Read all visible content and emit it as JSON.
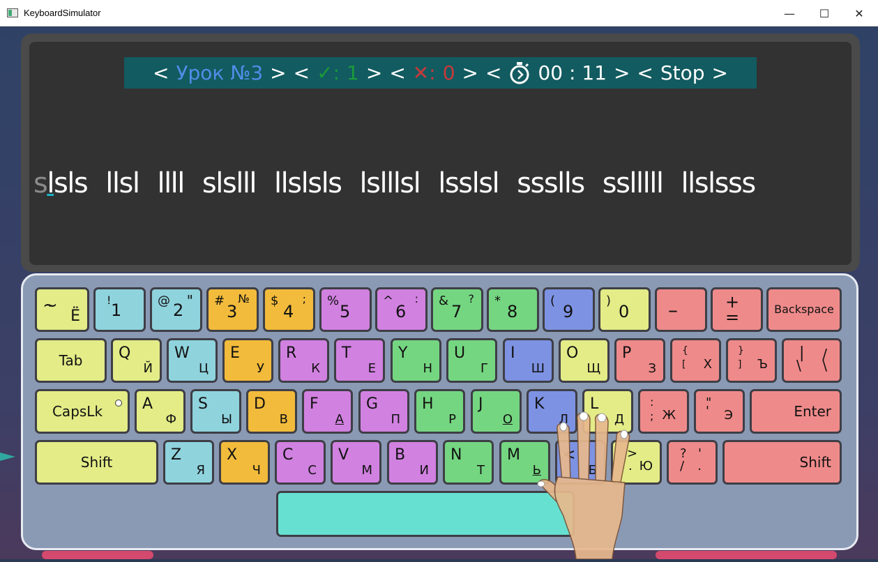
{
  "window": {
    "title": "KeyboardSimulator",
    "minimize": "—",
    "maximize": "☐",
    "close": "✕"
  },
  "status": {
    "lt1": "<",
    "lesson": "Урок №3",
    "gt1": ">",
    "lt2": "<",
    "correct_icon": "✓",
    "correct_label": ":",
    "correct": "1",
    "gt2": ">",
    "lt3": "<",
    "errors_icon": "✕",
    "errors_label": ":",
    "errors": "0",
    "gt3": ">",
    "lt4": "<",
    "time": "00 : 11",
    "gt4": ">",
    "lt5": "<",
    "stop": "Stop",
    "gt5": ">"
  },
  "exercise": {
    "typed": "s",
    "current": "l",
    "first_rest": "sls",
    "words": [
      "llsl",
      "llll",
      "slslll",
      "llslsls",
      "lslllsl",
      "lsslsl",
      "ssslls",
      "sslllll",
      "llslsss"
    ]
  },
  "keys": {
    "r1": [
      {
        "tl": "~",
        "bl": "`",
        "br": "Ё"
      },
      {
        "tl": "!",
        "main": "1"
      },
      {
        "tl": "@",
        "main": "2",
        "tr": "\""
      },
      {
        "tl": "#",
        "main": "3",
        "tr": "№"
      },
      {
        "tl": "$",
        "main": "4",
        "tr": ";"
      },
      {
        "tl": "%",
        "main": "5"
      },
      {
        "tl": "^",
        "main": "6",
        "tr": ":"
      },
      {
        "tl": "&",
        "main": "7",
        "tr": "?"
      },
      {
        "tl": "*",
        "main": "8"
      },
      {
        "tl": "(",
        "main": "9"
      },
      {
        "tl": ")",
        "main": "0"
      },
      {
        "main": "–"
      },
      {
        "tl": "+",
        "main": "="
      },
      {
        "label": "Backspace"
      }
    ],
    "r2": [
      {
        "label": "Tab"
      },
      {
        "tl": "Q",
        "br": "Й"
      },
      {
        "tl": "W",
        "br": "Ц"
      },
      {
        "tl": "E",
        "br": "У"
      },
      {
        "tl": "R",
        "br": "К"
      },
      {
        "tl": "T",
        "br": "Е"
      },
      {
        "tl": "Y",
        "br": "Н"
      },
      {
        "tl": "U",
        "br": "Г"
      },
      {
        "tl": "I",
        "br": "Ш"
      },
      {
        "tl": "O",
        "br": "Щ"
      },
      {
        "tl": "P",
        "br": "З"
      },
      {
        "tl": "{",
        "bl": "[",
        "br": "Х"
      },
      {
        "tl": "}",
        "bl": "]",
        "br": "Ъ"
      },
      {
        "tl": "|",
        "bl": "\\",
        "tr": "/",
        "br": "\\"
      }
    ],
    "r3": [
      {
        "label": "CapsLk"
      },
      {
        "tl": "A",
        "br": "Ф"
      },
      {
        "tl": "S",
        "br": "Ы"
      },
      {
        "tl": "D",
        "br": "В"
      },
      {
        "tl": "F",
        "br": "А"
      },
      {
        "tl": "G",
        "br": "П"
      },
      {
        "tl": "H",
        "br": "Р"
      },
      {
        "tl": "J",
        "br": "О"
      },
      {
        "tl": "K",
        "br": "Л"
      },
      {
        "tl": "L",
        "br": "Д"
      },
      {
        "tl": ":",
        "bl": ";",
        "br": "Ж"
      },
      {
        "tl": "\"",
        "bl": "'",
        "br": "Э"
      },
      {
        "label": "Enter"
      }
    ],
    "r4": [
      {
        "label": "Shift"
      },
      {
        "tl": "Z",
        "br": "Я"
      },
      {
        "tl": "X",
        "br": "Ч"
      },
      {
        "tl": "C",
        "br": "С"
      },
      {
        "tl": "V",
        "br": "М"
      },
      {
        "tl": "B",
        "br": "И"
      },
      {
        "tl": "N",
        "br": "Т"
      },
      {
        "tl": "M",
        "br": "Ь"
      },
      {
        "tl": "<",
        "br": "Б"
      },
      {
        "tl": ">",
        "bl": ".",
        "br": "Ю"
      },
      {
        "tl": "?",
        "bl": "/",
        "tr": "'",
        "br": "."
      },
      {
        "label": "Shift"
      }
    ],
    "space": ""
  },
  "colors": {
    "yellow": "#e3ec87",
    "cyan": "#8fd3dd",
    "orange": "#f2bb3b",
    "purple": "#d181e0",
    "green": "#75d681",
    "blue": "#7d92e2",
    "red": "#ef8a8a",
    "space": "#66e0d0",
    "status_bg": "#125b60",
    "lesson": "#4f8ee8",
    "correct": "#1b9a3a",
    "errors": "#c73a3a"
  },
  "icons": {
    "timer": "stopwatch-icon",
    "hand": "hand-icon"
  }
}
